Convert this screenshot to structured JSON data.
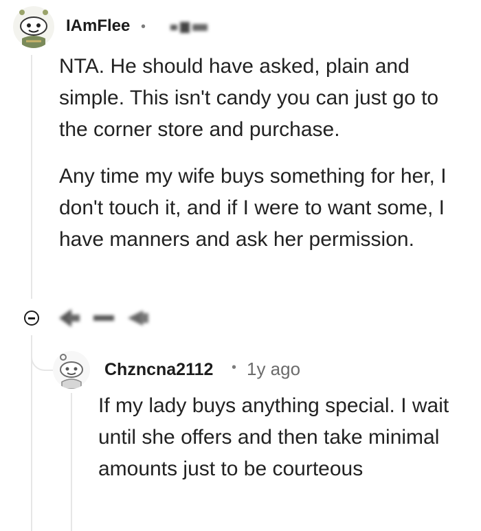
{
  "comment": {
    "username": "IAmFlee",
    "separator": "•",
    "paragraphs": [
      "NTA. He should have asked, plain and simple. This isn't candy you can just go to the corner store and purchase.",
      "Any time my wife buys something for her, I don't touch it, and if I were to want some, I have manners and ask her permission."
    ]
  },
  "reply": {
    "username": "Chzncna2112",
    "separator": "•",
    "timestamp": "1y ago",
    "text": "If my lady buys anything special. I wait until she offers and then take minimal amounts just to be courteous"
  },
  "icons": {
    "collapse": "collapse-minus-icon",
    "avatar_main": "snoo-avatar",
    "avatar_reply": "snoo-avatar-outline"
  }
}
